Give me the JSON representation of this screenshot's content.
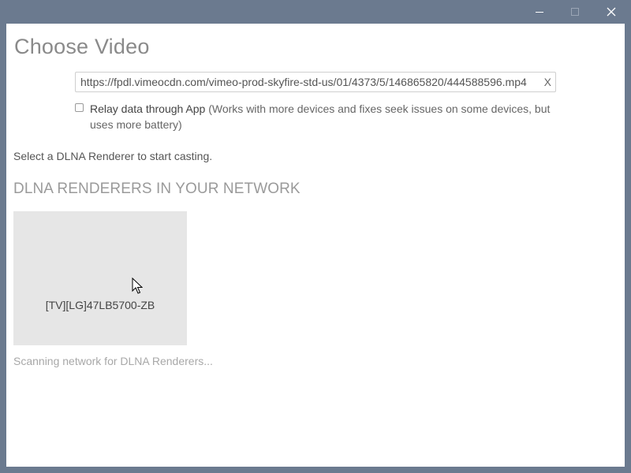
{
  "window": {
    "controls": {
      "minimize_icon": "minimize-icon",
      "maximize_icon": "maximize-icon",
      "close_icon": "close-icon"
    }
  },
  "page": {
    "title": "Choose Video"
  },
  "url_field": {
    "value": "https://fpdl.vimeocdn.com/vimeo-prod-skyfire-std-us/01/4373/5/146865820/444588596.mp4",
    "clear_label": "X"
  },
  "relay": {
    "checked": false,
    "label": "Relay data through App",
    "description": "(Works with more devices and fixes seek issues on some devices, but uses more battery)"
  },
  "hint": "Select a DLNA Renderer to start casting.",
  "renderers": {
    "heading": "DLNA RENDERERS IN YOUR NETWORK",
    "items": [
      {
        "name": "[TV][LG]47LB5700-ZB"
      }
    ],
    "status": "Scanning network for DLNA Renderers..."
  },
  "colors": {
    "titlebar": "#6b7a8f",
    "tile": "#e6e6e6"
  }
}
